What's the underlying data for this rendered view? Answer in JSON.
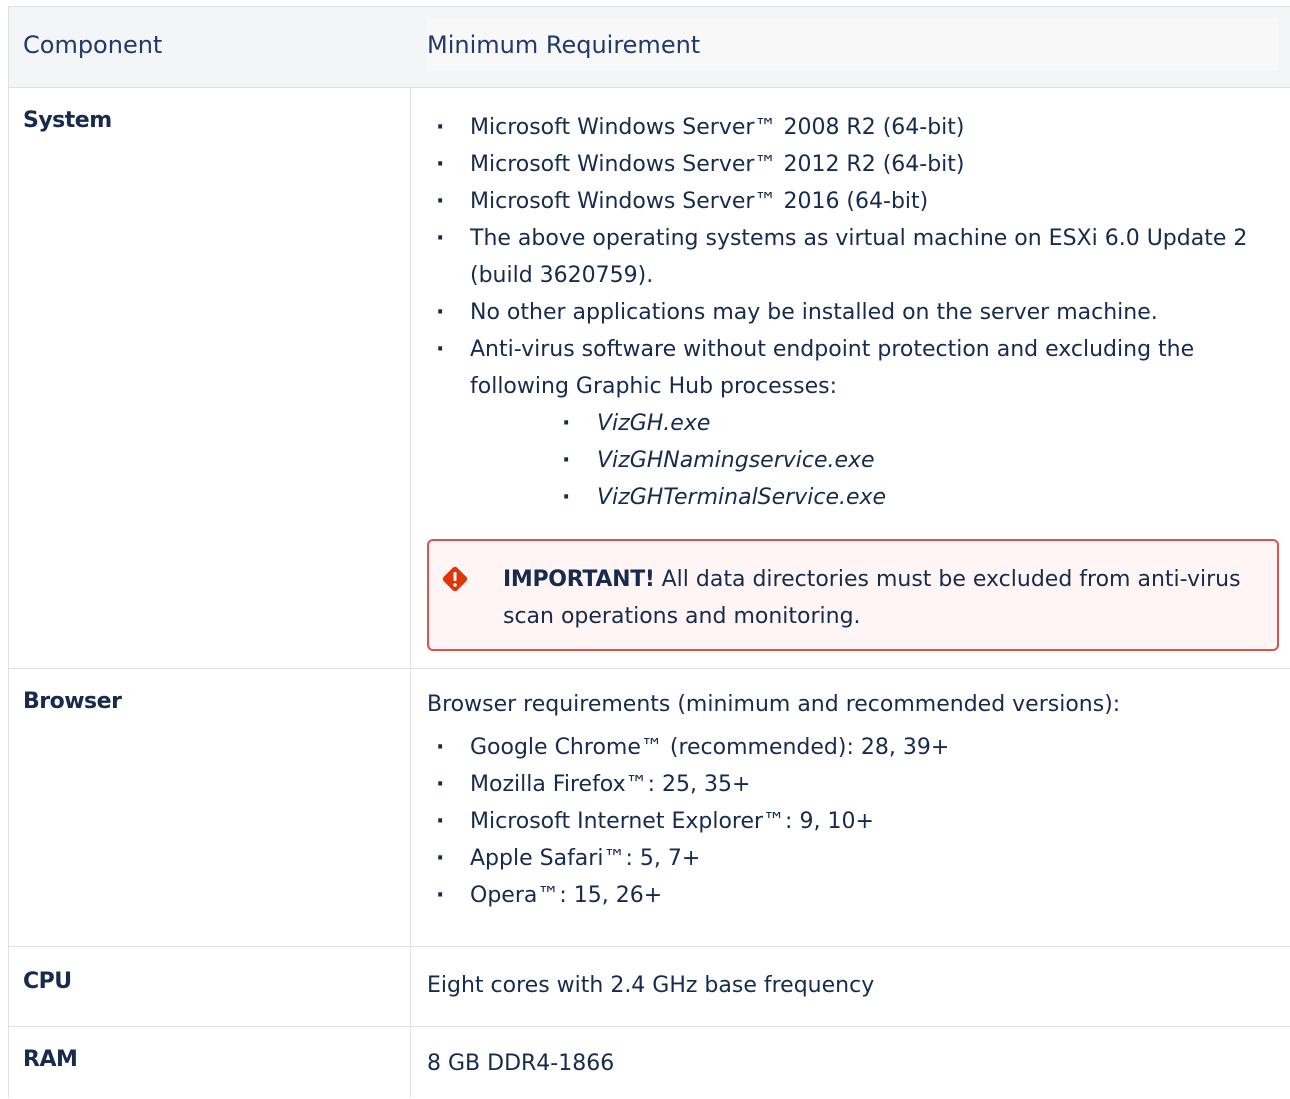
{
  "header": {
    "col1": "Component",
    "col2": "Minimum Requirement"
  },
  "rows": {
    "system": {
      "label": "System",
      "items": [
        "Microsoft Windows Server™ 2008 R2 (64-bit)",
        "Microsoft Windows Server™ 2012 R2 (64-bit)",
        "Microsoft Windows Server™ 2016 (64-bit)",
        "The above operating systems as virtual machine on ESXi 6.0 Update 2 (build 3620759).",
        "No other applications may be installed on the server machine.",
        "Anti-virus software without endpoint protection and excluding the following Graphic Hub processes:"
      ],
      "processes": [
        "VizGH.exe",
        "VizGHNamingservice.exe",
        "VizGHTerminalService.exe"
      ],
      "alert": {
        "icon": "warning-diamond-icon",
        "strong": "IMPORTANT!",
        "text": " All data directories must be excluded from anti-virus scan operations and monitoring.",
        "border_color": "#d9534f"
      }
    },
    "browser": {
      "label": "Browser",
      "intro": "Browser requirements (minimum and recommended versions):",
      "items": [
        "Google Chrome™ (recommended): 28, 39+",
        "Mozilla Firefox™: 25, 35+",
        "Microsoft Internet Explorer™: 9, 10+",
        "Apple Safari™: 5, 7+",
        "Opera™: 15, 26+"
      ]
    },
    "cpu": {
      "label": "CPU",
      "value": "Eight cores with 2.4 GHz base frequency"
    },
    "ram": {
      "label": "RAM",
      "value": "8 GB DDR4-1866"
    }
  }
}
